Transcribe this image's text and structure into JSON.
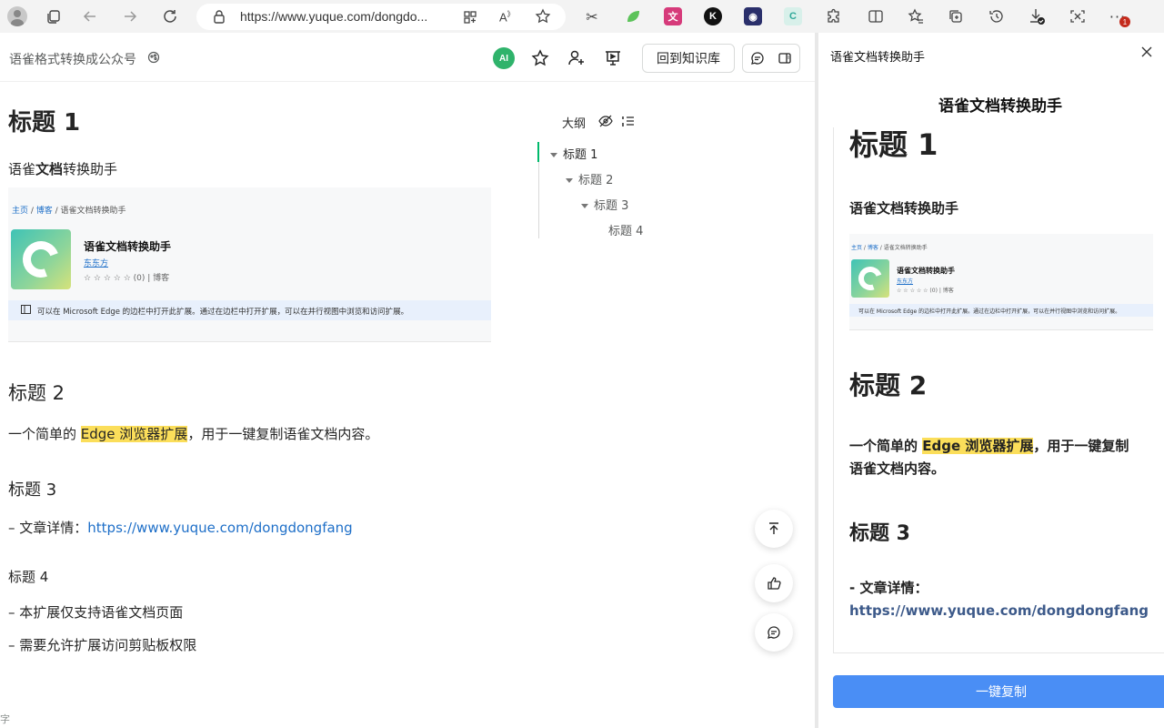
{
  "browser": {
    "url": "https://www.yuque.com/dongdo...",
    "notification_badge": "1"
  },
  "doc": {
    "title": "语雀格式转换成公众号",
    "ai_label": "AI",
    "back_button": "回到知识库"
  },
  "content": {
    "h1": "标题 1",
    "p1_pre": "语雀",
    "p1_bold": "文档",
    "p1_post": "转换助手",
    "embed": {
      "bc_home": "主页",
      "bc_sep1": " / ",
      "bc_blog": "博客",
      "bc_rest": " / 语雀文档转换助手",
      "name": "语雀文档转换助手",
      "author": "东东方",
      "rating": "☆ ☆ ☆ ☆ ☆  (0)  |  博客",
      "note": "可以在 Microsoft Edge 的边栏中打开此扩展。通过在边栏中打开扩展，可以在并行视图中浏览和访问扩展。"
    },
    "h2": "标题 2",
    "p2_pre": "一个简单的 ",
    "p2_hl": "Edge 浏览器扩展",
    "p2_post": "，用于一键复制语雀文档内容。",
    "h3": "标题 3",
    "p3_pre": "– 文章详情：",
    "p3_link": "https://www.yuque.com/dongdongfang",
    "h4": "标题 4",
    "li1": "– 本扩展仅支持语雀文档页面",
    "li2": "– 需要允许扩展访问剪贴板权限",
    "wordcount": "字"
  },
  "outline": {
    "title": "大纲",
    "items": [
      "标题 1",
      "标题 2",
      "标题 3",
      "标题 4"
    ]
  },
  "panel": {
    "header": "语雀文档转换助手",
    "title": "语雀文档转换助手",
    "preview": {
      "h1": "标题 1",
      "p1": "语雀文档转换助手",
      "h2": "标题 2",
      "p2_pre": "一个简单的 ",
      "p2_hl": "Edge 浏览器扩展",
      "p2_post": "，用于一键复制",
      "p2_line2": "语雀文档内容。",
      "h3": "标题 3",
      "p3_pre": "- 文章详情：",
      "p3_link": "https://www.yuque.com/dongdongfang"
    },
    "copy_button": "一键复制"
  },
  "colors": {
    "accent_green": "#00b96b",
    "highlight": "#fbde5a",
    "link": "#1e6fc8",
    "copy_button": "#4a8ef5"
  }
}
